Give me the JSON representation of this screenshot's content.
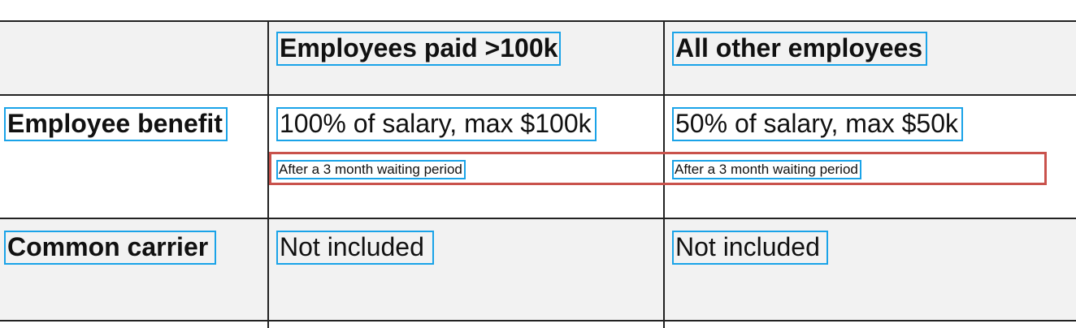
{
  "table": {
    "header": {
      "col1": "Employees paid >100k",
      "col2": "All other employees"
    },
    "rows": [
      {
        "label": "Employee benefit",
        "col1": "100% of salary, max $100k",
        "col1_note": "After a 3 month waiting period",
        "col2": "50% of salary, max $50k",
        "col2_note": "After a 3 month waiting period"
      },
      {
        "label": "Common carrier",
        "col1": "Not included",
        "col2": "Not included"
      }
    ]
  },
  "colors": {
    "header_bg": "#f2f2f2",
    "border": "#222222",
    "element_outline": "#1aa3e8",
    "highlight": "#c9524c"
  }
}
